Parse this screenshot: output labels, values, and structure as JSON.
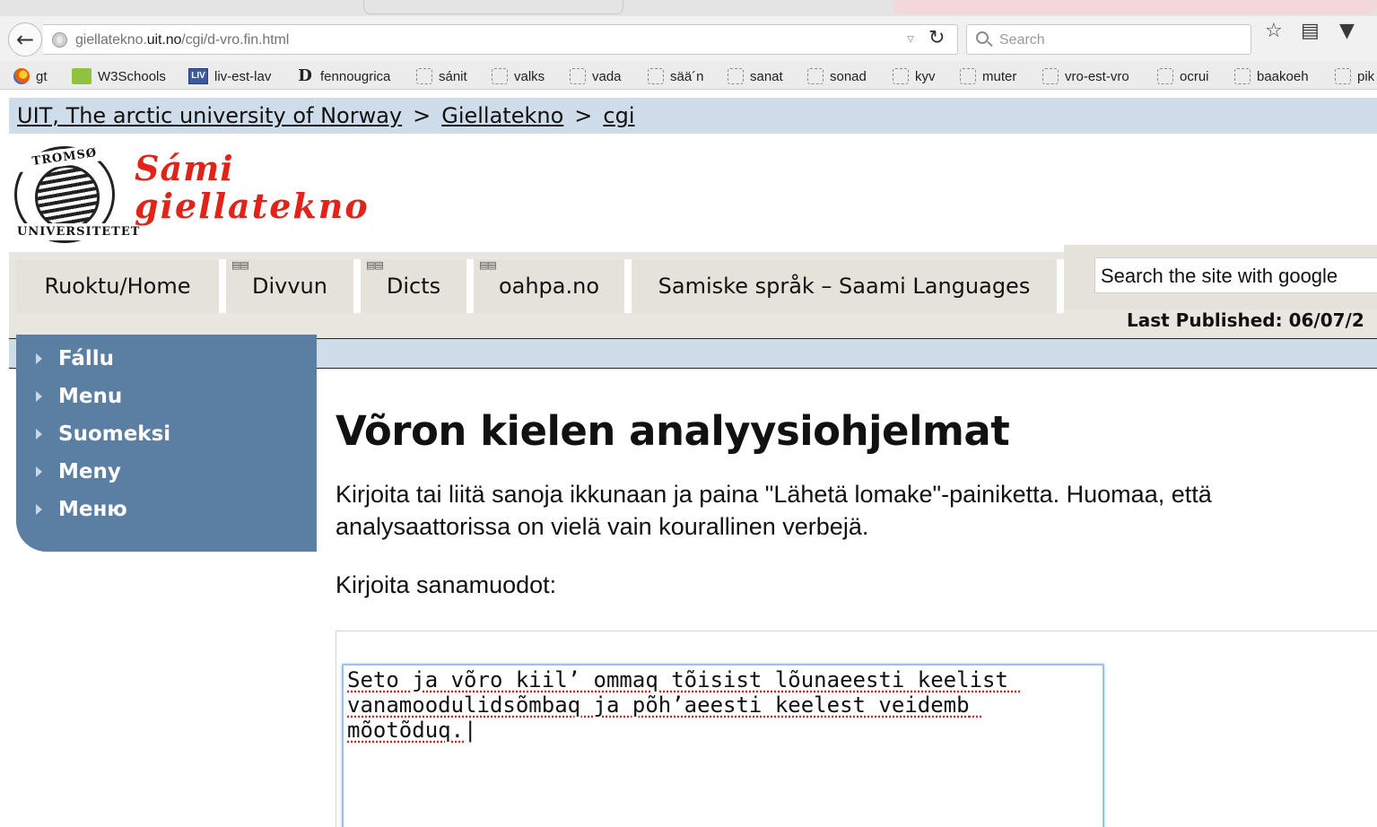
{
  "browser": {
    "url_host": "giellatekno.",
    "url_domain": "uit.no",
    "url_path": "/cgi/d-vro.fin.html",
    "search_placeholder": "Search"
  },
  "bookmarks": [
    "gt",
    "W3Schools",
    "liv-est-lav",
    "fennougrica",
    "sánit",
    "valks",
    "vada",
    "sää´n",
    "sanat",
    "sonad",
    "kyv",
    "muter",
    "vro-est-vro",
    "ocrui",
    "baakoeh",
    "pik"
  ],
  "bookmark_icons": {
    "liv": "LIV",
    "fennougrica": "D"
  },
  "breadcrumb": {
    "items": [
      "UIT, The arctic university of Norway",
      "Giellatekno",
      "cgi"
    ],
    "separator": ">"
  },
  "logo": {
    "seal_top": "TROMSØ",
    "seal_bottom": "UNIVERSITETET",
    "line1": "Sámi",
    "line2": "giellatekno"
  },
  "topnav": {
    "items": [
      "Ruoktu/Home",
      "Divvun",
      "Dicts",
      "oahpa.no",
      "Samiske språk – Saami Languages"
    ],
    "search_placeholder": "Search the site with google",
    "last_published": "Last Published: 06/07/2"
  },
  "sidebar": {
    "items": [
      "Fállu",
      "Menu",
      "Suomeksi",
      "Meny",
      "Меню"
    ]
  },
  "main": {
    "title": "Võron kielen analyysiohjelmat",
    "intro": "Kirjoita tai liitä sanoja ikkunaan ja paina \"Lähetä lomake\"-painiketta. Huomaa, että analysaattorissa on vielä vain kourallinen verbejä.",
    "prompt": "Kirjoita sanamuodot:",
    "textarea_value": "Seto ja võro kiil’ ommaq tõisist lõunaeesti keelist vanamoodulidsõmbaq ja põh’aeesti keelest veidemb mõotõduq."
  },
  "colors": {
    "crumb_bg": "#cfdcea",
    "sidebar_bg": "#5b7ea3",
    "nav_bg": "#e4e2d9",
    "logo_red": "#e2231a"
  }
}
